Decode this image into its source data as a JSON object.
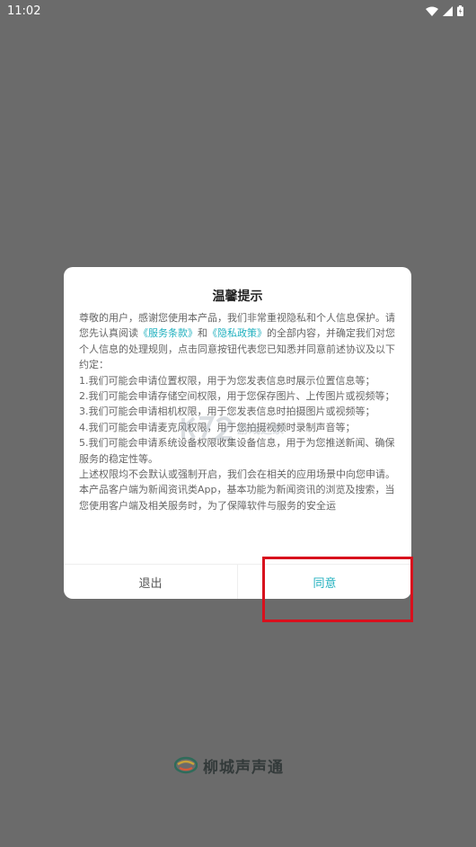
{
  "status_bar": {
    "time": "11:02",
    "icons": [
      "wifi-icon",
      "cellular-signal-icon",
      "battery-icon"
    ]
  },
  "dialog": {
    "title": "温馨提示",
    "body": {
      "p1_part1": "尊敬的用户，感谢您使用本产品，我们非常重视隐私和个人信息保护。请您先认真阅读",
      "link_terms": "《服务条款》",
      "p1_and": "和",
      "link_privacy": "《隐私政策》",
      "p1_part2": "的全部内容，并确定我们对您个人信息的处理规则，点击同意按钮代表您已知悉并同意前述协议及以下约定：",
      "items": [
        "1.我们可能会申请位置权限，用于为您发表信息时展示位置信息等；",
        "2.我们可能会申请存储空间权限，用于您保存图片、上传图片或视频等；",
        "3.我们可能会申请相机权限，用于您发表信息时拍摄图片或视频等；",
        "4.我们可能会申请麦克风权限，用于您拍摄视频时录制声音等；",
        "5.我们可能会申请系统设备权限收集设备信息，用于为您推送新闻、确保服务的稳定性等。"
      ],
      "p_notice": "上述权限均不会默认或强制开启，我们会在相关的应用场景中向您申请。",
      "p_last": "本产品客户端为新闻资讯类App，基本功能为新闻资讯的浏览及搜索，当您使用客户端及相关服务时，为了保障软件与服务的安全运"
    },
    "exit_label": "退出",
    "agree_label": "同意"
  },
  "watermark": {
    "text": "游戏之家"
  },
  "brand": {
    "name": "柳城声声通"
  },
  "colors": {
    "overlay": "#6b6b6b",
    "link": "#22b1bf",
    "highlight": "#d8101d"
  }
}
